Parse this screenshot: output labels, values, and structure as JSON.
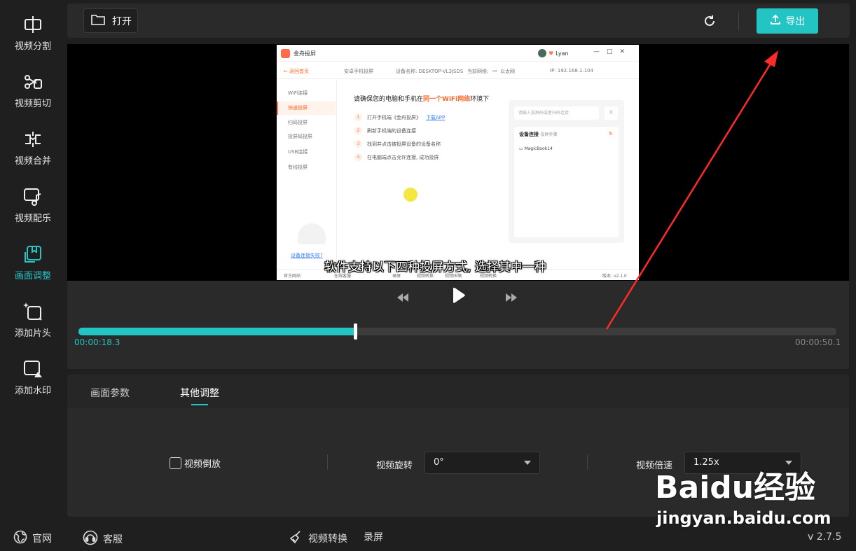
{
  "sidebar": {
    "items": [
      {
        "label": "视频分割",
        "icon": "split-icon"
      },
      {
        "label": "视频剪切",
        "icon": "scissors-icon"
      },
      {
        "label": "视频合并",
        "icon": "merge-icon"
      },
      {
        "label": "视频配乐",
        "icon": "music-icon"
      },
      {
        "label": "画面调整",
        "icon": "frame-adjust-icon",
        "active": true
      },
      {
        "label": "添加片头",
        "icon": "sparkle-icon"
      },
      {
        "label": "添加水印",
        "icon": "watermark-icon"
      }
    ]
  },
  "toolbar": {
    "open_label": "打开",
    "export_label": "导出"
  },
  "preview": {
    "app_name": "金舟投屏",
    "user_name": "Lyan",
    "win_buttons": [
      "—",
      "□",
      "✕"
    ],
    "back_label": "返回首页",
    "sub_info": [
      "安卓手机投屏",
      "设备名称: DESKTOP-VL3JSDS",
      "当前网络: ",
      "以太网",
      "IP: 192.168.1.104"
    ],
    "left_menu": {
      "wifi_group": "WiFi连接",
      "quick": "快速投屏",
      "scan": "扫码投屏",
      "code": "投屏码投屏",
      "usb_group": "USB连接",
      "wired": "有线投屏",
      "fail_link": "设备连接失败?"
    },
    "heading_pre": "请确保您的电脑和手机在",
    "heading_hl": "同一个WiFi网络",
    "heading_post": "环境下",
    "steps": [
      {
        "num": "1",
        "text": "打开手机端《金舟投屏》",
        "link": "下载APP"
      },
      {
        "num": "2",
        "text": "刷新手机端的设备连接"
      },
      {
        "num": "3",
        "text": "找到并点击被投屏设备的设备名称"
      },
      {
        "num": "4",
        "text": "在电脑端点击允许连接, 成功投屏"
      }
    ],
    "input_placeholder": "请输入投屏码或者扫码连接",
    "device_title": "设备连接",
    "device_hint": "投屏步骤",
    "device_item": "MagicBook14",
    "bottom": [
      "官方网站",
      "在线客服",
      "录屏",
      "视频转换",
      "视频压缩",
      "视频转换"
    ],
    "version": "版本: v2.1.0",
    "subtitle": "软件支持以下四种投屏方式, 选择其中一种"
  },
  "player": {
    "current_time": "00:00:18.3",
    "total_time": "00:00:50.1",
    "progress": 0.365
  },
  "settings": {
    "tabs": [
      "画面参数",
      "其他调整"
    ],
    "active_tab": 1,
    "reverse_label": "视频倒放",
    "reverse_checked": false,
    "rotate_label": "视频旋转",
    "rotate_value": "0°",
    "speed_label": "视频倍速",
    "speed_value": "1.25x"
  },
  "footer": {
    "website": "官网",
    "service": "客服",
    "convert": "视频转换",
    "record": "录屏",
    "version": "v 2.7.5"
  },
  "watermark": {
    "main": "Baidu经验",
    "sub": "jingyan.baidu.com"
  },
  "colors": {
    "accent": "#23c4c4",
    "annotation_arrow": "#ff2a2a",
    "brand_orange": "#ff6a2b"
  }
}
